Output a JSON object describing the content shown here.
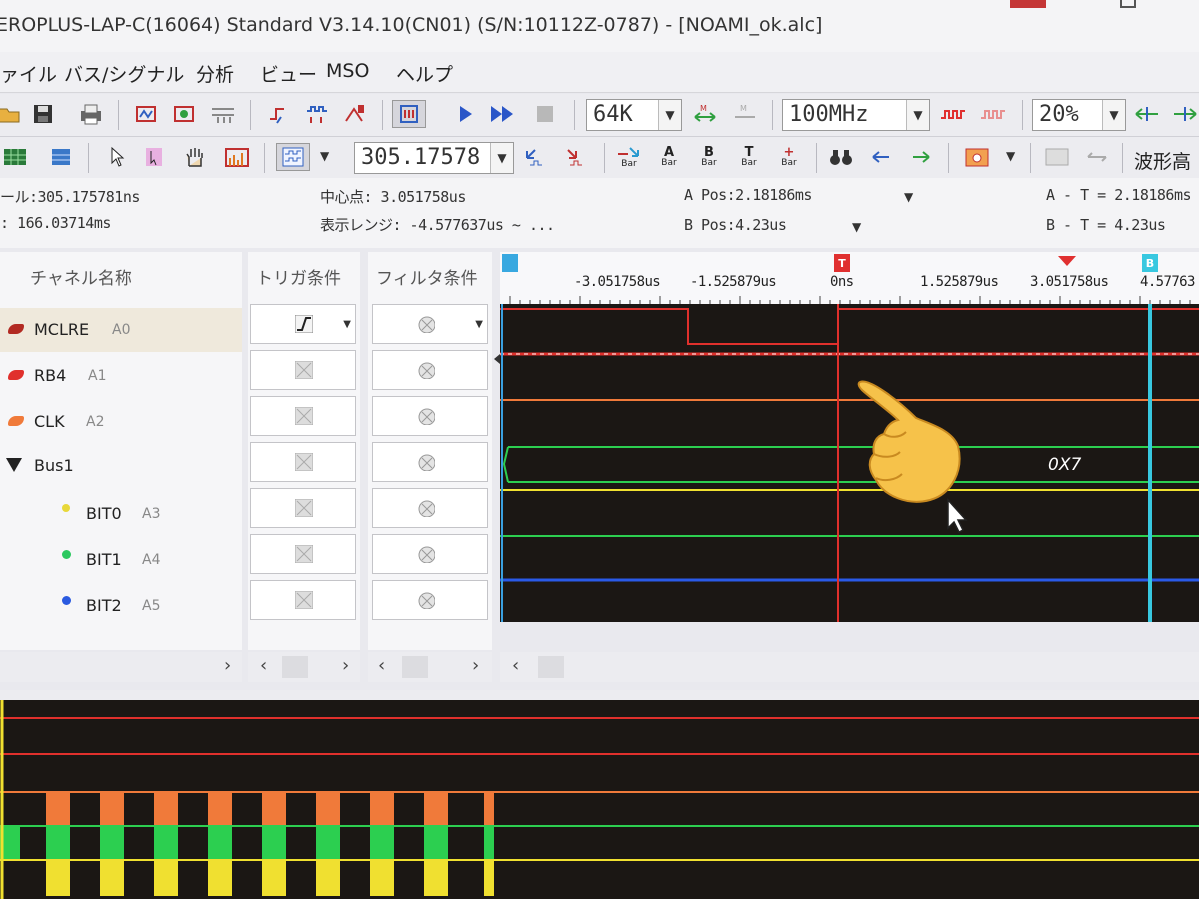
{
  "window": {
    "title": "EROPLUS-LAP-C(16064) Standard V3.14.10(CN01) (S/N:10112Z-0787) - [NOAMI_ok.alc]"
  },
  "menu": [
    "ァイル",
    "バス/シグナル",
    "分析",
    "ビュー",
    "MSO",
    "ヘルプ"
  ],
  "toolbar1": {
    "memory_depth": "64K",
    "sample_rate": "100MHz",
    "zoom": "20%"
  },
  "toolbar2": {
    "time_value": "305.17578",
    "bar_labels": [
      "Bar",
      "Bar",
      "Bar",
      "Bar",
      "Bar"
    ],
    "bar_letters": [
      "",
      "A",
      "B",
      "T",
      ""
    ],
    "waveform_label": "波形高"
  },
  "info": {
    "scale": "ール:305.175781ns",
    "time": ": 166.03714ms",
    "center_point": "中心点: 3.051758us",
    "display_range": "表示レンジ: -4.577637us ~ ...",
    "a_pos": "A Pos:2.18186ms",
    "b_pos": "B Pos:4.23us",
    "a_minus_t": "A - T = 2.18186ms",
    "b_minus_t": "B - T = 4.23us"
  },
  "columns": {
    "channel_name": "チャネル名称",
    "trigger": "トリガ条件",
    "filter": "フィルタ条件"
  },
  "channels": [
    {
      "name": "MCLRE",
      "id": "A0",
      "color": "#b22a22"
    },
    {
      "name": "RB4",
      "id": "A1",
      "color": "#e0302c"
    },
    {
      "name": "CLK",
      "id": "A2",
      "color": "#f07a3a"
    },
    {
      "name": "Bus1",
      "id": "",
      "color": "#222222"
    },
    {
      "name": "BIT0",
      "id": "A3",
      "color": "#e8d83a"
    },
    {
      "name": "BIT1",
      "id": "A4",
      "color": "#2cc860"
    },
    {
      "name": "BIT2",
      "id": "A5",
      "color": "#2a5ae0"
    }
  ],
  "ruler": {
    "labels": [
      "-3.051758us",
      "-1.525879us",
      "0ns",
      "1.525879us",
      "3.051758us",
      "4.57763"
    ],
    "trigger_marker": "T",
    "b_marker": "B"
  },
  "bus_value": "0X7",
  "colors": {
    "wave_bg": "#1b1714",
    "mclre": "#e0302c",
    "clk": "#f07a3a",
    "bit0": "#f0e030",
    "bit1": "#2ccf50",
    "bit2": "#2a5ae8",
    "cursor_b": "#38c8e0"
  }
}
